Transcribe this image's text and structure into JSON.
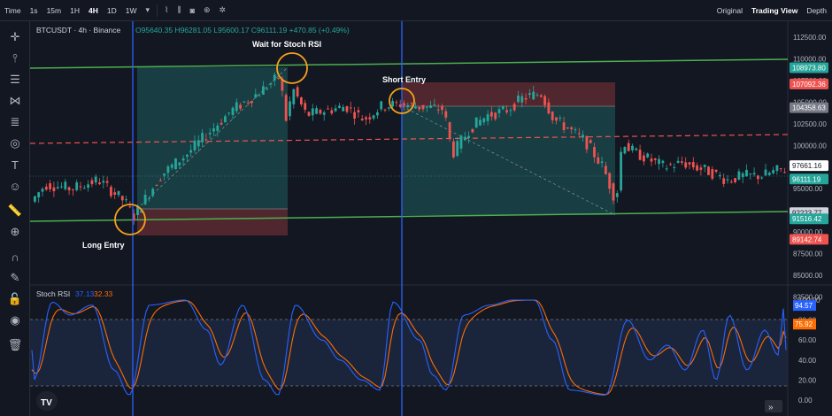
{
  "topbar": {
    "items": [
      "Time",
      "1s",
      "15m",
      "1H",
      "4H",
      "1D",
      "1W"
    ],
    "active": "4H",
    "right": [
      "Original",
      "Trading View",
      "Depth"
    ],
    "right_selected": "Trading View"
  },
  "toolbar_icons": [
    "crosshair-icon",
    "vertical-line-icon",
    "horizontal-lines-icon",
    "pattern-icon",
    "fib-icon",
    "shapes-icon",
    "text-icon",
    "emoji-icon",
    "ruler-icon",
    "zoom-in-icon",
    "magnet-icon",
    "lock-icon",
    "eye-icon",
    "trash-icon"
  ],
  "legend": {
    "symbol": "BTCUSDT · 4h · Binance",
    "ohlc": "O95640.35 H96281.05 L95600.17 C96111.19 +470.85 (+0.49%)"
  },
  "annotations": {
    "wait": "Wait for Stoch RSI",
    "short": "Short Entry",
    "long": "Long Entry"
  },
  "price_axis": {
    "ticks": [
      "112500.00",
      "110000.00",
      "107500.00",
      "105000.00",
      "102500.00",
      "100000.00",
      "97500.00",
      "95000.00",
      "92500.00",
      "90000.00",
      "87500.00",
      "85000.00",
      "82500.00"
    ],
    "tags": [
      {
        "value": 108973.8,
        "label": "108973.80",
        "color": "#26a69a"
      },
      {
        "value": 107092.36,
        "label": "107092.36",
        "color": "#ef5350"
      },
      {
        "value": 104358.63,
        "label": "104358.63",
        "color": "#787b86"
      },
      {
        "value": 97661.16,
        "label": "97661.16",
        "color": "#ffffff"
      },
      {
        "value": 96111.19,
        "label": "96111.19",
        "color": "#26a69a"
      },
      {
        "value": 92223.77,
        "label": "92223.77",
        "color": "#d1d4dc"
      },
      {
        "value": 91516.42,
        "label": "91516.42",
        "color": "#26a69a"
      },
      {
        "value": 89142.74,
        "label": "89142.74",
        "color": "#ef5350"
      }
    ]
  },
  "stoch": {
    "label": "Stoch RSI",
    "k": "37.13",
    "d": "32.33",
    "ticks": [
      "100.00",
      "80.00",
      "60.00",
      "40.00",
      "20.00",
      "0.00"
    ],
    "k_tag": "94.57",
    "d_tag": "75.92",
    "k_color": "#2962ff",
    "d_color": "#ff6d00"
  },
  "colors": {
    "up": "#26a69a",
    "down": "#ef5350",
    "channel": "#4caf50",
    "vline": "#2962ff",
    "circle": "#f7a21b"
  },
  "logo": "TV"
}
